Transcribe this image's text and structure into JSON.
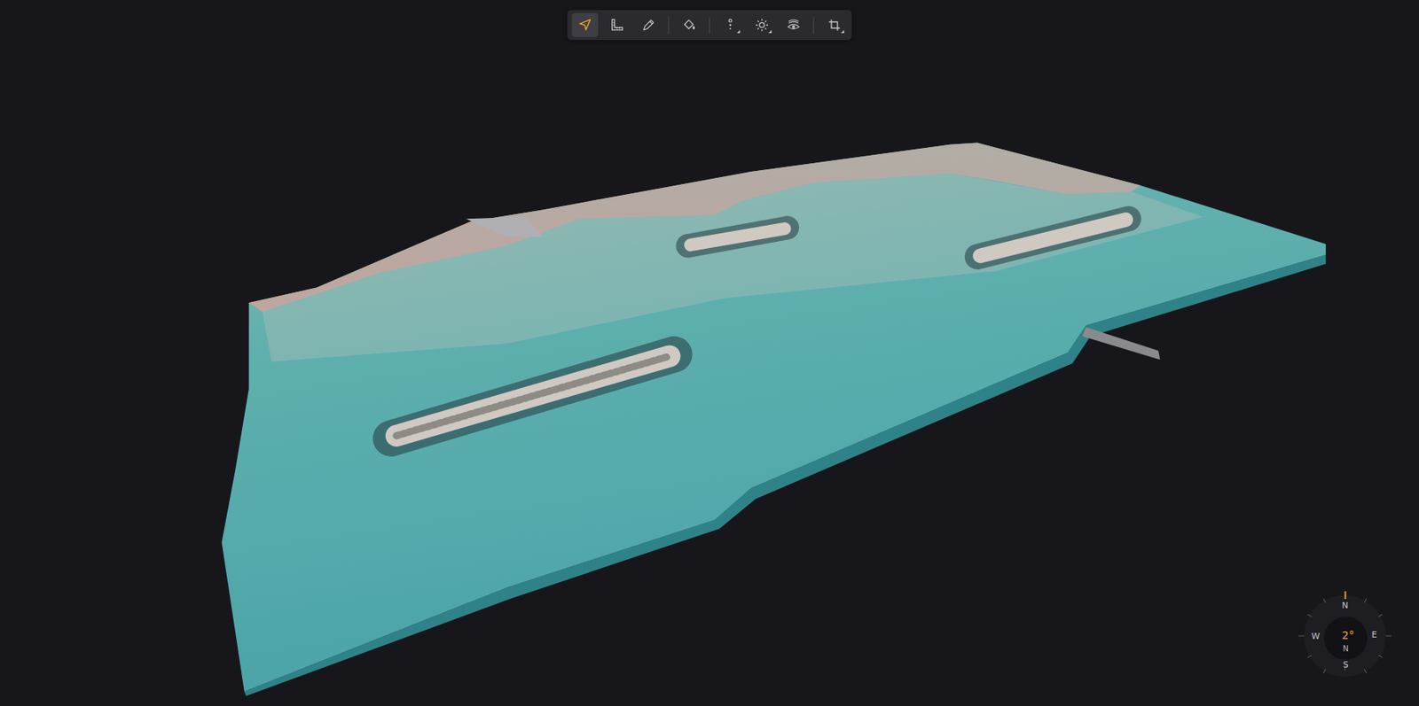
{
  "toolbar": {
    "groups": [
      {
        "tools": [
          {
            "kind": "navigate",
            "selected": true,
            "dropdown": false
          },
          {
            "kind": "measure",
            "selected": false,
            "dropdown": false
          },
          {
            "kind": "draw",
            "selected": false,
            "dropdown": false
          }
        ]
      },
      {
        "tools": [
          {
            "kind": "fill",
            "selected": false,
            "dropdown": false
          }
        ]
      },
      {
        "tools": [
          {
            "kind": "points",
            "selected": false,
            "dropdown": true
          },
          {
            "kind": "light",
            "selected": false,
            "dropdown": true
          },
          {
            "kind": "layers",
            "selected": false,
            "dropdown": false
          }
        ]
      },
      {
        "tools": [
          {
            "kind": "crop",
            "selected": false,
            "dropdown": true
          }
        ]
      }
    ]
  },
  "compass": {
    "north": "N",
    "east": "E",
    "south": "S",
    "west": "W",
    "heading": "2°",
    "heading_ref": "N"
  }
}
